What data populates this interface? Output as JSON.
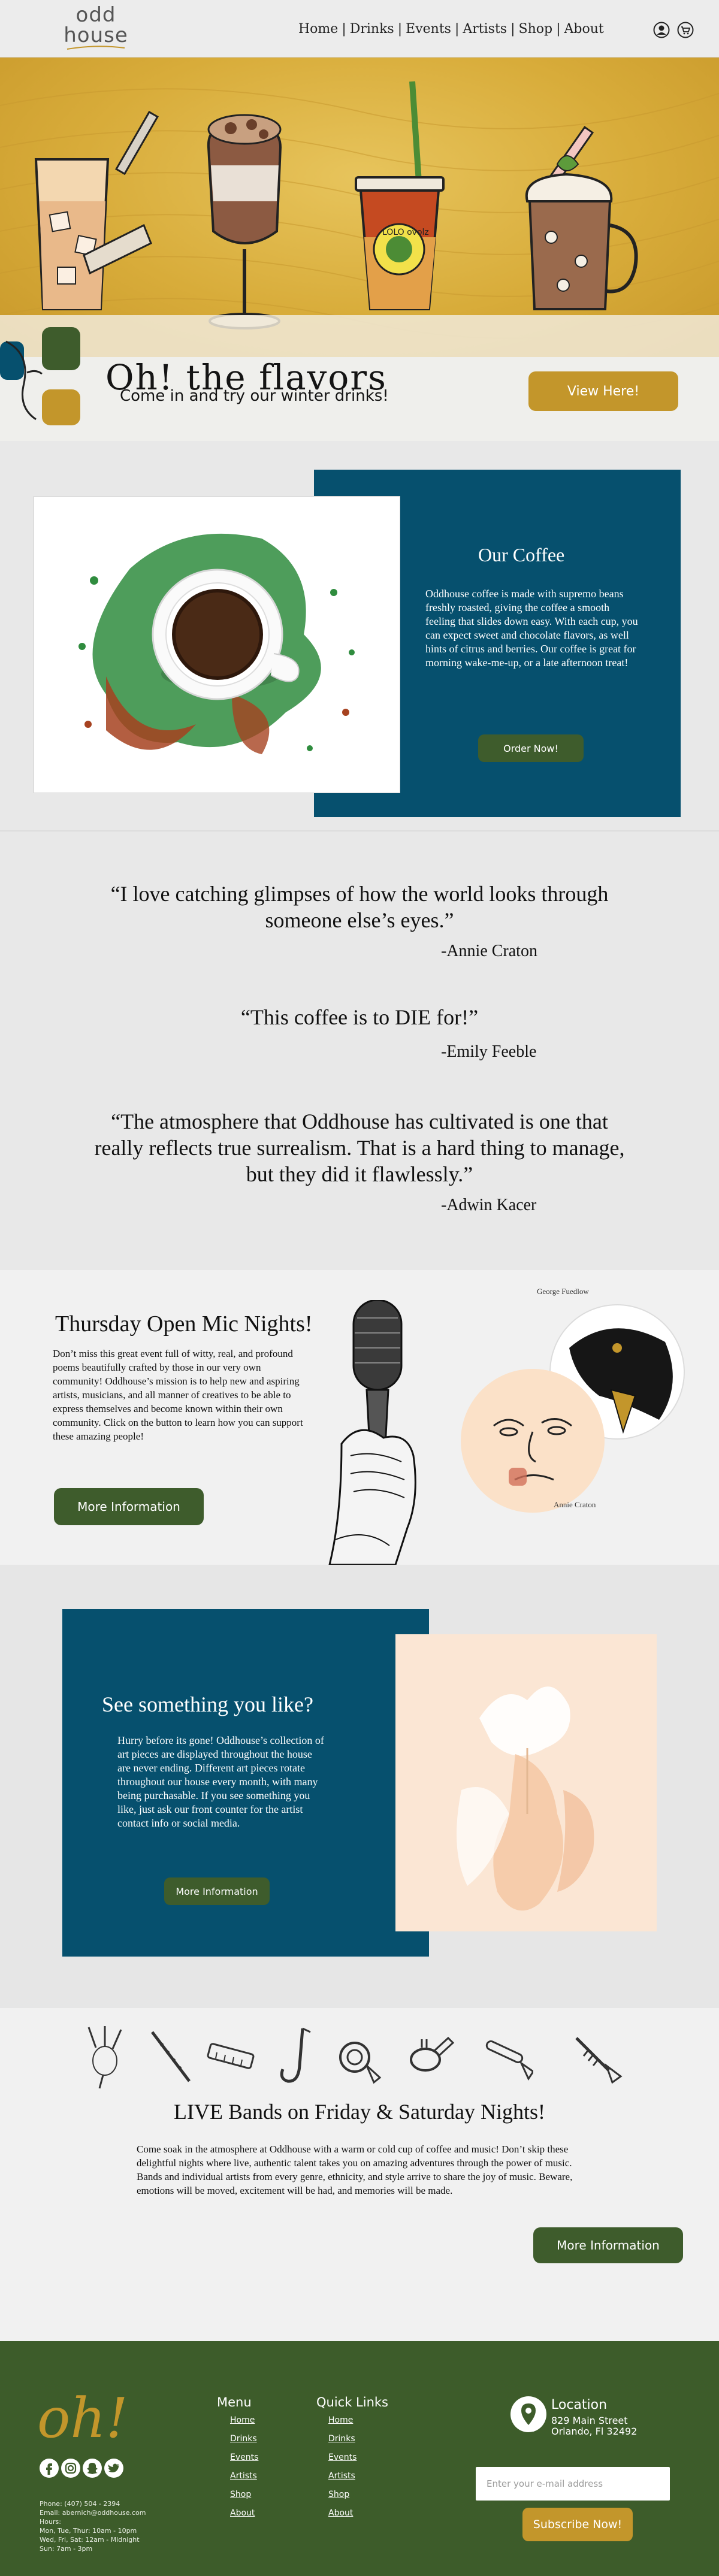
{
  "header": {
    "logo_line1": "odd",
    "logo_line2": "house",
    "nav": [
      {
        "label": "Home"
      },
      {
        "label": "Drinks"
      },
      {
        "label": "Events"
      },
      {
        "label": "Artists"
      },
      {
        "label": "Shop"
      },
      {
        "label": "About"
      }
    ],
    "separator": "|",
    "icons": [
      "account-icon",
      "cart-icon"
    ]
  },
  "hero": {
    "cup_label": "LOLO ovolz",
    "promo_title": "Oh! the flavors",
    "promo_subtitle": "Come in and try our winter drinks!",
    "promo_button": "View Here!"
  },
  "coffee": {
    "title": "Our Coffee",
    "text": "Oddhouse coffee is made with supremo beans freshly roasted, giving the coffee a smooth feeling that slides down easy. With each cup, you can expect sweet and chocolate flavors, as well hints of citrus and berries. Our coffee is great for morning wake-me-up, or a late afternoon treat!",
    "button": "Order Now!"
  },
  "testimonials": [
    {
      "quote": "“I love catching glimpses of how the world looks through someone else’s eyes.”",
      "author": "-Annie Craton"
    },
    {
      "quote": "“This coffee is to DIE for!”",
      "author": "-Emily Feeble"
    },
    {
      "quote": "“The atmosphere that Oddhouse has cultivated is one that really reflects true surrealism. That is a hard thing to manage, but they did it flawlessly.”",
      "author": "-Adwin Kacer"
    }
  ],
  "open_mic": {
    "title": "Thursday Open Mic Nights!",
    "text": "Don’t miss this great event full of witty, real, and profound poems beautifully crafted by those in our very own community! Oddhouse’s mission is to help new and aspiring artists, musicians, and all manner of creatives to be able to express themselves and become known within their own community. Click on the button to learn how you can support these amazing people!",
    "button": "More Information",
    "artist_1": "George Fuedlow",
    "artist_2": "Annie Craton"
  },
  "art": {
    "title": "See something you like?",
    "text": "Hurry before its gone! Oddhouse’s collection of art pieces are displayed throughout the house are never ending. Different art pieces rotate throughout our house every month, with many being purchasable. If you see something you like, just ask our front counter for the artist contact info or social media.",
    "button": "More Information"
  },
  "bands": {
    "instruments": [
      "bagpipe-icon",
      "flute-icon",
      "harmonica-icon",
      "saxophone-icon",
      "french-horn-icon",
      "tuba-icon",
      "trombone-icon",
      "trumpet-icon"
    ],
    "title": "LIVE Bands on Friday & Saturday Nights!",
    "text": "Come soak in the atmosphere at Oddhouse with a warm or cold cup of coffee and music! Don’t skip these delightful nights where live, authentic talent takes you on amazing adventures through the power of music. Bands and individual artists from every genre, ethnicity, and style arrive to share the joy of music. Beware, emotions will be moved, excitement will be had, and memories will be made.",
    "button": "More Information"
  },
  "footer": {
    "logo": "oh!",
    "social": [
      "facebook-icon",
      "instagram-icon",
      "snapchat-icon",
      "twitter-icon"
    ],
    "contact": [
      "Phone: (407) 504 - 2394",
      "Email: abernich@oddhouse.com",
      "Hours:",
      "Mon, Tue, Thur: 10am - 10pm",
      "Wed, Fri, Sat: 12am - Midnight",
      "Sun: 7am - 3pm"
    ],
    "menu_title": "Menu",
    "menu_links": [
      "Home",
      "Drinks",
      "Events",
      "Artists",
      "Shop",
      "About"
    ],
    "quick_title": "Quick Links",
    "quick_links": [
      "Home",
      "Drinks",
      "Events",
      "Artists",
      "Shop",
      "About"
    ],
    "location_title": "Location",
    "address_1": "829 Main Street",
    "address_2": "Orlando, Fl 32492",
    "email_placeholder": "Enter your e-mail address",
    "subscribe_button": "Subscribe Now!"
  },
  "colors": {
    "brand_blue": "#06506e",
    "brand_green": "#3e5c2c",
    "brand_gold": "#c3962b",
    "footer_green": "#3d5c2a"
  }
}
